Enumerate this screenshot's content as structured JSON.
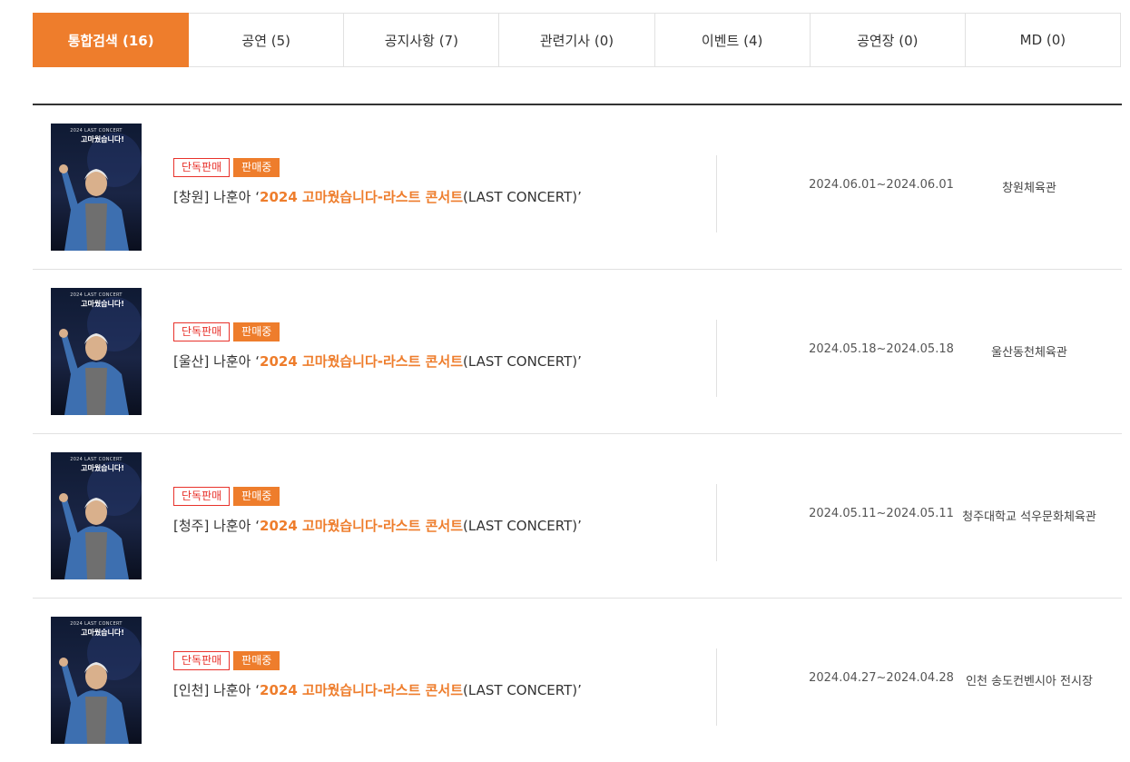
{
  "tabs": [
    {
      "label": "통합검색 (16)",
      "active": true
    },
    {
      "label": "공연 (5)",
      "active": false
    },
    {
      "label": "공지사항 (7)",
      "active": false
    },
    {
      "label": "관련기사 (0)",
      "active": false
    },
    {
      "label": "이벤트 (4)",
      "active": false
    },
    {
      "label": "공연장 (0)",
      "active": false
    },
    {
      "label": "MD (0)",
      "active": false
    }
  ],
  "poster": {
    "caption_small": "2024 LAST CONCERT",
    "caption_big": "고마웠습니다!"
  },
  "colors": {
    "accent": "#ee7d2c",
    "badge_red": "#e8322b"
  },
  "results": [
    {
      "badge_exclusive": "단독판매",
      "badge_status": "판매중",
      "title_prefix": "[창원] 나훈아 ‘",
      "title_highlight": "2024 고마웠습니다-라스트 콘서트",
      "title_suffix": "(LAST CONCERT)’",
      "date": "2024.06.01~2024.06.01",
      "venue": "창원체육관"
    },
    {
      "badge_exclusive": "단독판매",
      "badge_status": "판매중",
      "title_prefix": "[울산] 나훈아 ‘",
      "title_highlight": "2024 고마웠습니다-라스트 콘서트",
      "title_suffix": "(LAST CONCERT)’",
      "date": "2024.05.18~2024.05.18",
      "venue": "울산동천체육관"
    },
    {
      "badge_exclusive": "단독판매",
      "badge_status": "판매중",
      "title_prefix": "[청주] 나훈아 ‘",
      "title_highlight": "2024 고마웠습니다-라스트 콘서트",
      "title_suffix": "(LAST CONCERT)’",
      "date": "2024.05.11~2024.05.11",
      "venue": "청주대학교 석우문화체육관"
    },
    {
      "badge_exclusive": "단독판매",
      "badge_status": "판매중",
      "title_prefix": "[인천] 나훈아 ‘",
      "title_highlight": "2024 고마웠습니다-라스트 콘서트",
      "title_suffix": "(LAST CONCERT)’",
      "date": "2024.04.27~2024.04.28",
      "venue": "인천 송도컨벤시아 전시장"
    }
  ]
}
